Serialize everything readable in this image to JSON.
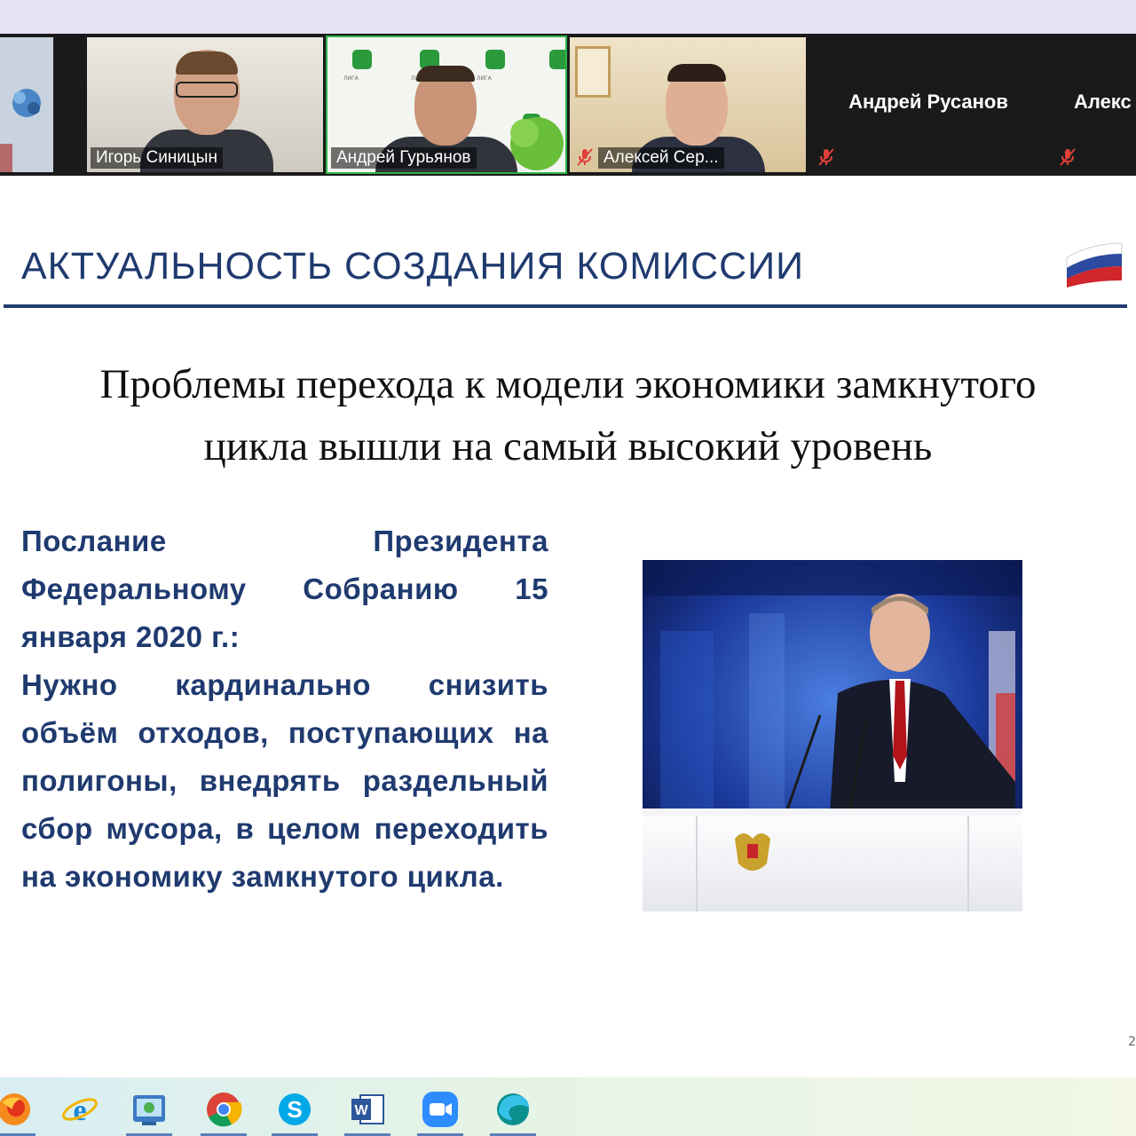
{
  "participants": [
    {
      "name": "",
      "muted": false
    },
    {
      "name": "Игорь Синицын",
      "muted": false
    },
    {
      "name": "Андрей Гурьянов",
      "muted": false
    },
    {
      "name": "Алексей Сер...",
      "muted": true
    },
    {
      "name": "Андрей Русанов",
      "muted": true
    },
    {
      "name": "Алекс",
      "muted": true
    }
  ],
  "slide": {
    "title": "АКТУАЛЬНОСТЬ СОЗДАНИЯ КОМИССИИ",
    "heading_line1": "Проблемы перехода к модели экономики замкнутого",
    "heading_line2": "цикла вышли на самый высокий уровень",
    "quote_intro": "Послание Президента Федеральному Собранию 15 января 2020 г.:",
    "quote_text": "Нужно кардинально снизить объём отходов, поступающих на полигоны, внедрять раздельный сбор мусора, в целом переходить на экономику замкнутого цикла.",
    "page_number": "2"
  },
  "taskbar": {
    "icons": [
      "firefox-icon",
      "internet-explorer-icon",
      "picture-viewer-icon",
      "chrome-icon",
      "skype-icon",
      "word-icon",
      "zoom-icon",
      "edge-icon"
    ]
  },
  "colors": {
    "slide_title": "#1f3a6f",
    "quote_text": "#1f3a6f",
    "strip_bg": "#1a1a1a"
  }
}
